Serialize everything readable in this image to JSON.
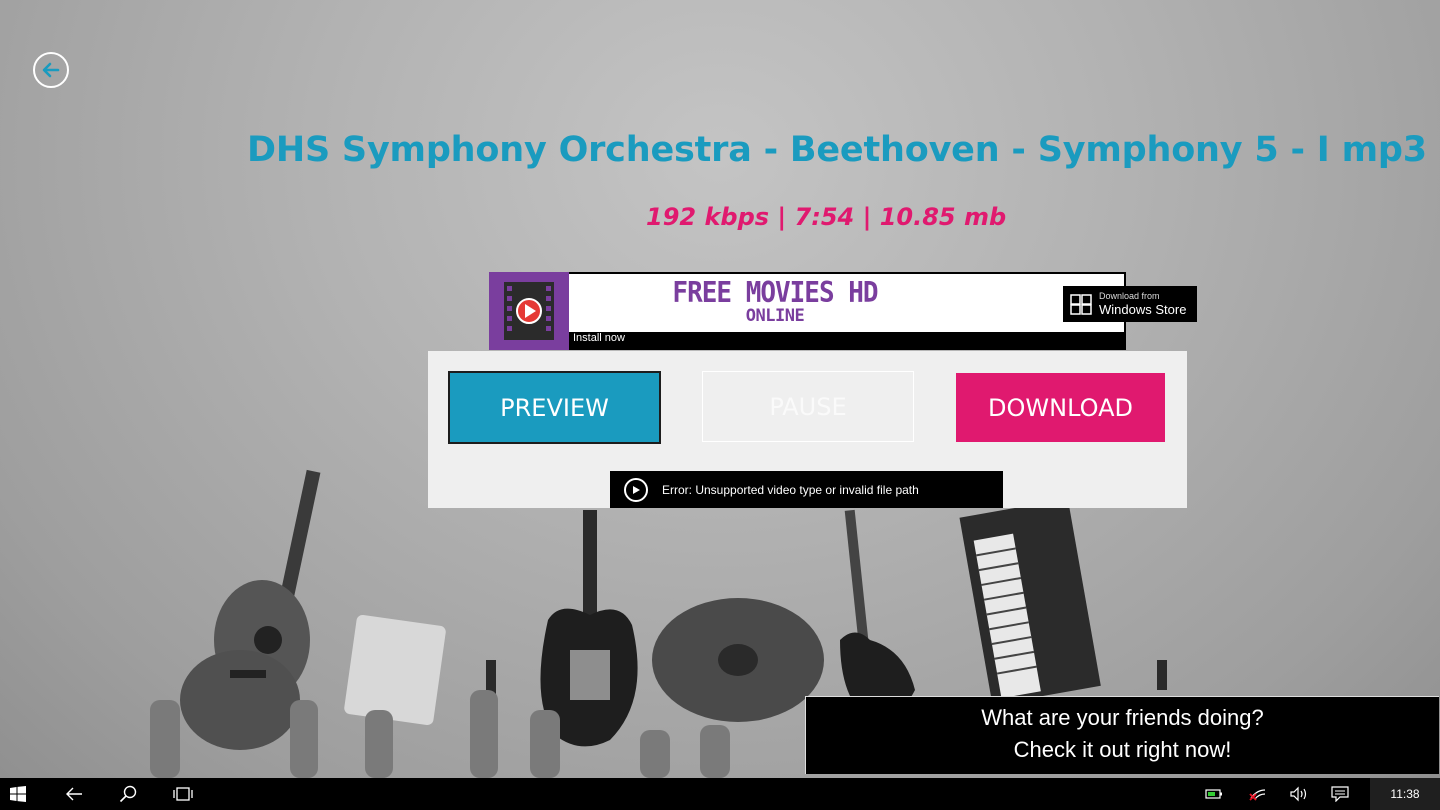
{
  "song": {
    "title": "DHS Symphony Orchestra - Beethoven - Symphony 5 - I mp3",
    "meta": "192 kbps | 7:54 | 10.85 mb"
  },
  "ad_banner": {
    "title": "FREE MOVIES HD",
    "subtitle": "ONLINE",
    "store_small": "Download from",
    "store_big": "Windows Store",
    "install": "Install now"
  },
  "controls": {
    "preview_label": "PREVIEW",
    "pause_label": "PAUSE",
    "download_label": "DOWNLOAD"
  },
  "player": {
    "error": "Error: Unsupported video type or invalid file path"
  },
  "friends_ad": {
    "line1": "What are your friends doing?",
    "line2": "Check it out right now!"
  },
  "taskbar": {
    "time": "11:38"
  },
  "colors": {
    "accent_blue": "#1a9bbf",
    "accent_pink": "#e0196f",
    "ad_purple": "#7a3e9e"
  }
}
